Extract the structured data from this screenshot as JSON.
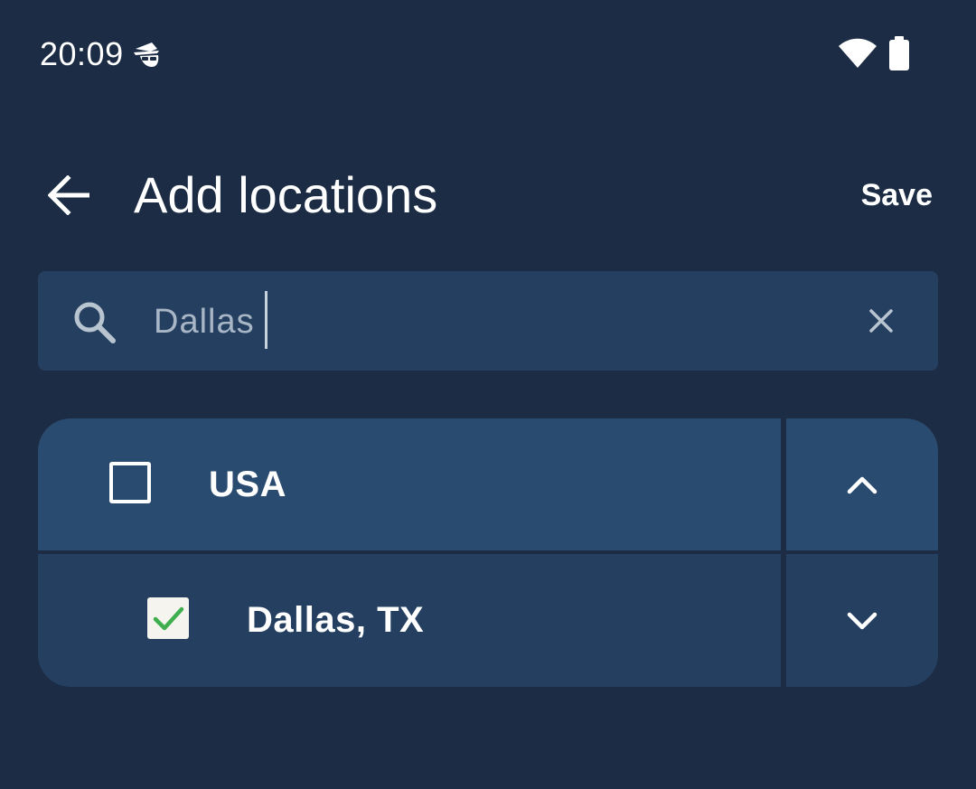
{
  "status_bar": {
    "time": "20:09",
    "icons": [
      "spy-icon",
      "wifi-icon",
      "battery-icon"
    ]
  },
  "app_bar": {
    "back_icon": "arrow-left-icon",
    "title": "Add locations",
    "save_label": "Save"
  },
  "search": {
    "icon": "search-icon",
    "value": "Dallas",
    "clear_icon": "close-icon"
  },
  "locations": [
    {
      "label": "USA",
      "checked": false,
      "expand_icon": "chevron-up-icon"
    },
    {
      "label": "Dallas, TX",
      "checked": true,
      "expand_icon": "chevron-down-icon"
    }
  ],
  "colors": {
    "background": "#1b2c44",
    "search_background": "#243f60",
    "parent_row": "#2a4b70",
    "child_row": "#243f60",
    "check_green": "#3fae4f",
    "text": "#ffffff",
    "input_text": "#a8b6c6"
  }
}
